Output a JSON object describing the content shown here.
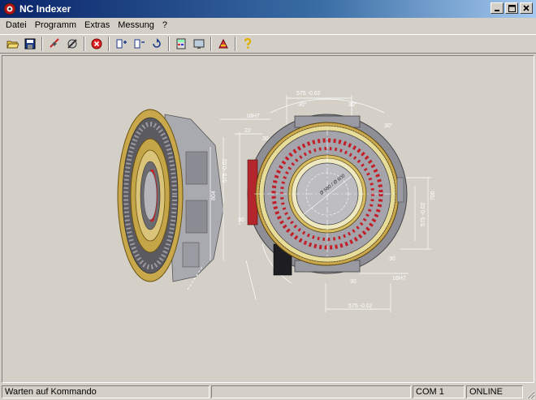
{
  "window": {
    "title": "NC Indexer"
  },
  "menu": [
    {
      "id": "datei",
      "label": "Datei"
    },
    {
      "id": "programm",
      "label": "Programm"
    },
    {
      "id": "extras",
      "label": "Extras"
    },
    {
      "id": "messung",
      "label": "Messung"
    },
    {
      "id": "help",
      "label": "?"
    }
  ],
  "toolbar": [
    {
      "name": "open-folder-icon"
    },
    {
      "name": "save-disk-icon"
    },
    {
      "name": "sep"
    },
    {
      "name": "disconnect-icon"
    },
    {
      "name": "tools-icon"
    },
    {
      "name": "sep"
    },
    {
      "name": "stop-icon"
    },
    {
      "name": "sep"
    },
    {
      "name": "position-plus-icon"
    },
    {
      "name": "position-minus-icon"
    },
    {
      "name": "rotate-icon"
    },
    {
      "name": "sep"
    },
    {
      "name": "calculator-icon"
    },
    {
      "name": "display-icon"
    },
    {
      "name": "sep"
    },
    {
      "name": "marker-icon"
    },
    {
      "name": "sep"
    },
    {
      "name": "help-icon"
    }
  ],
  "drawing": {
    "dimensions": {
      "top_width": "575 -0.02",
      "bottom_width": "575 -0.02",
      "top_angle_left": "30°",
      "top_angle_right": "30°",
      "top_angle_left2": "30°",
      "fit_top": "16H7",
      "fit_bottom": "16H7",
      "small_a": "22",
      "small_b": "30",
      "left_height": "575 -0.02",
      "right_height": "575 -0.02",
      "height_outer": "804",
      "right_outer": "700",
      "bottom_angle_left": "30",
      "bottom_angle_right": "30",
      "bottom_angle_lower": "30",
      "left_angle": "30",
      "center_dia": "Ø 580 / Ø 600"
    }
  },
  "status": {
    "message": "Warten auf Kommando",
    "port": "COM 1",
    "connection": "ONLINE"
  }
}
